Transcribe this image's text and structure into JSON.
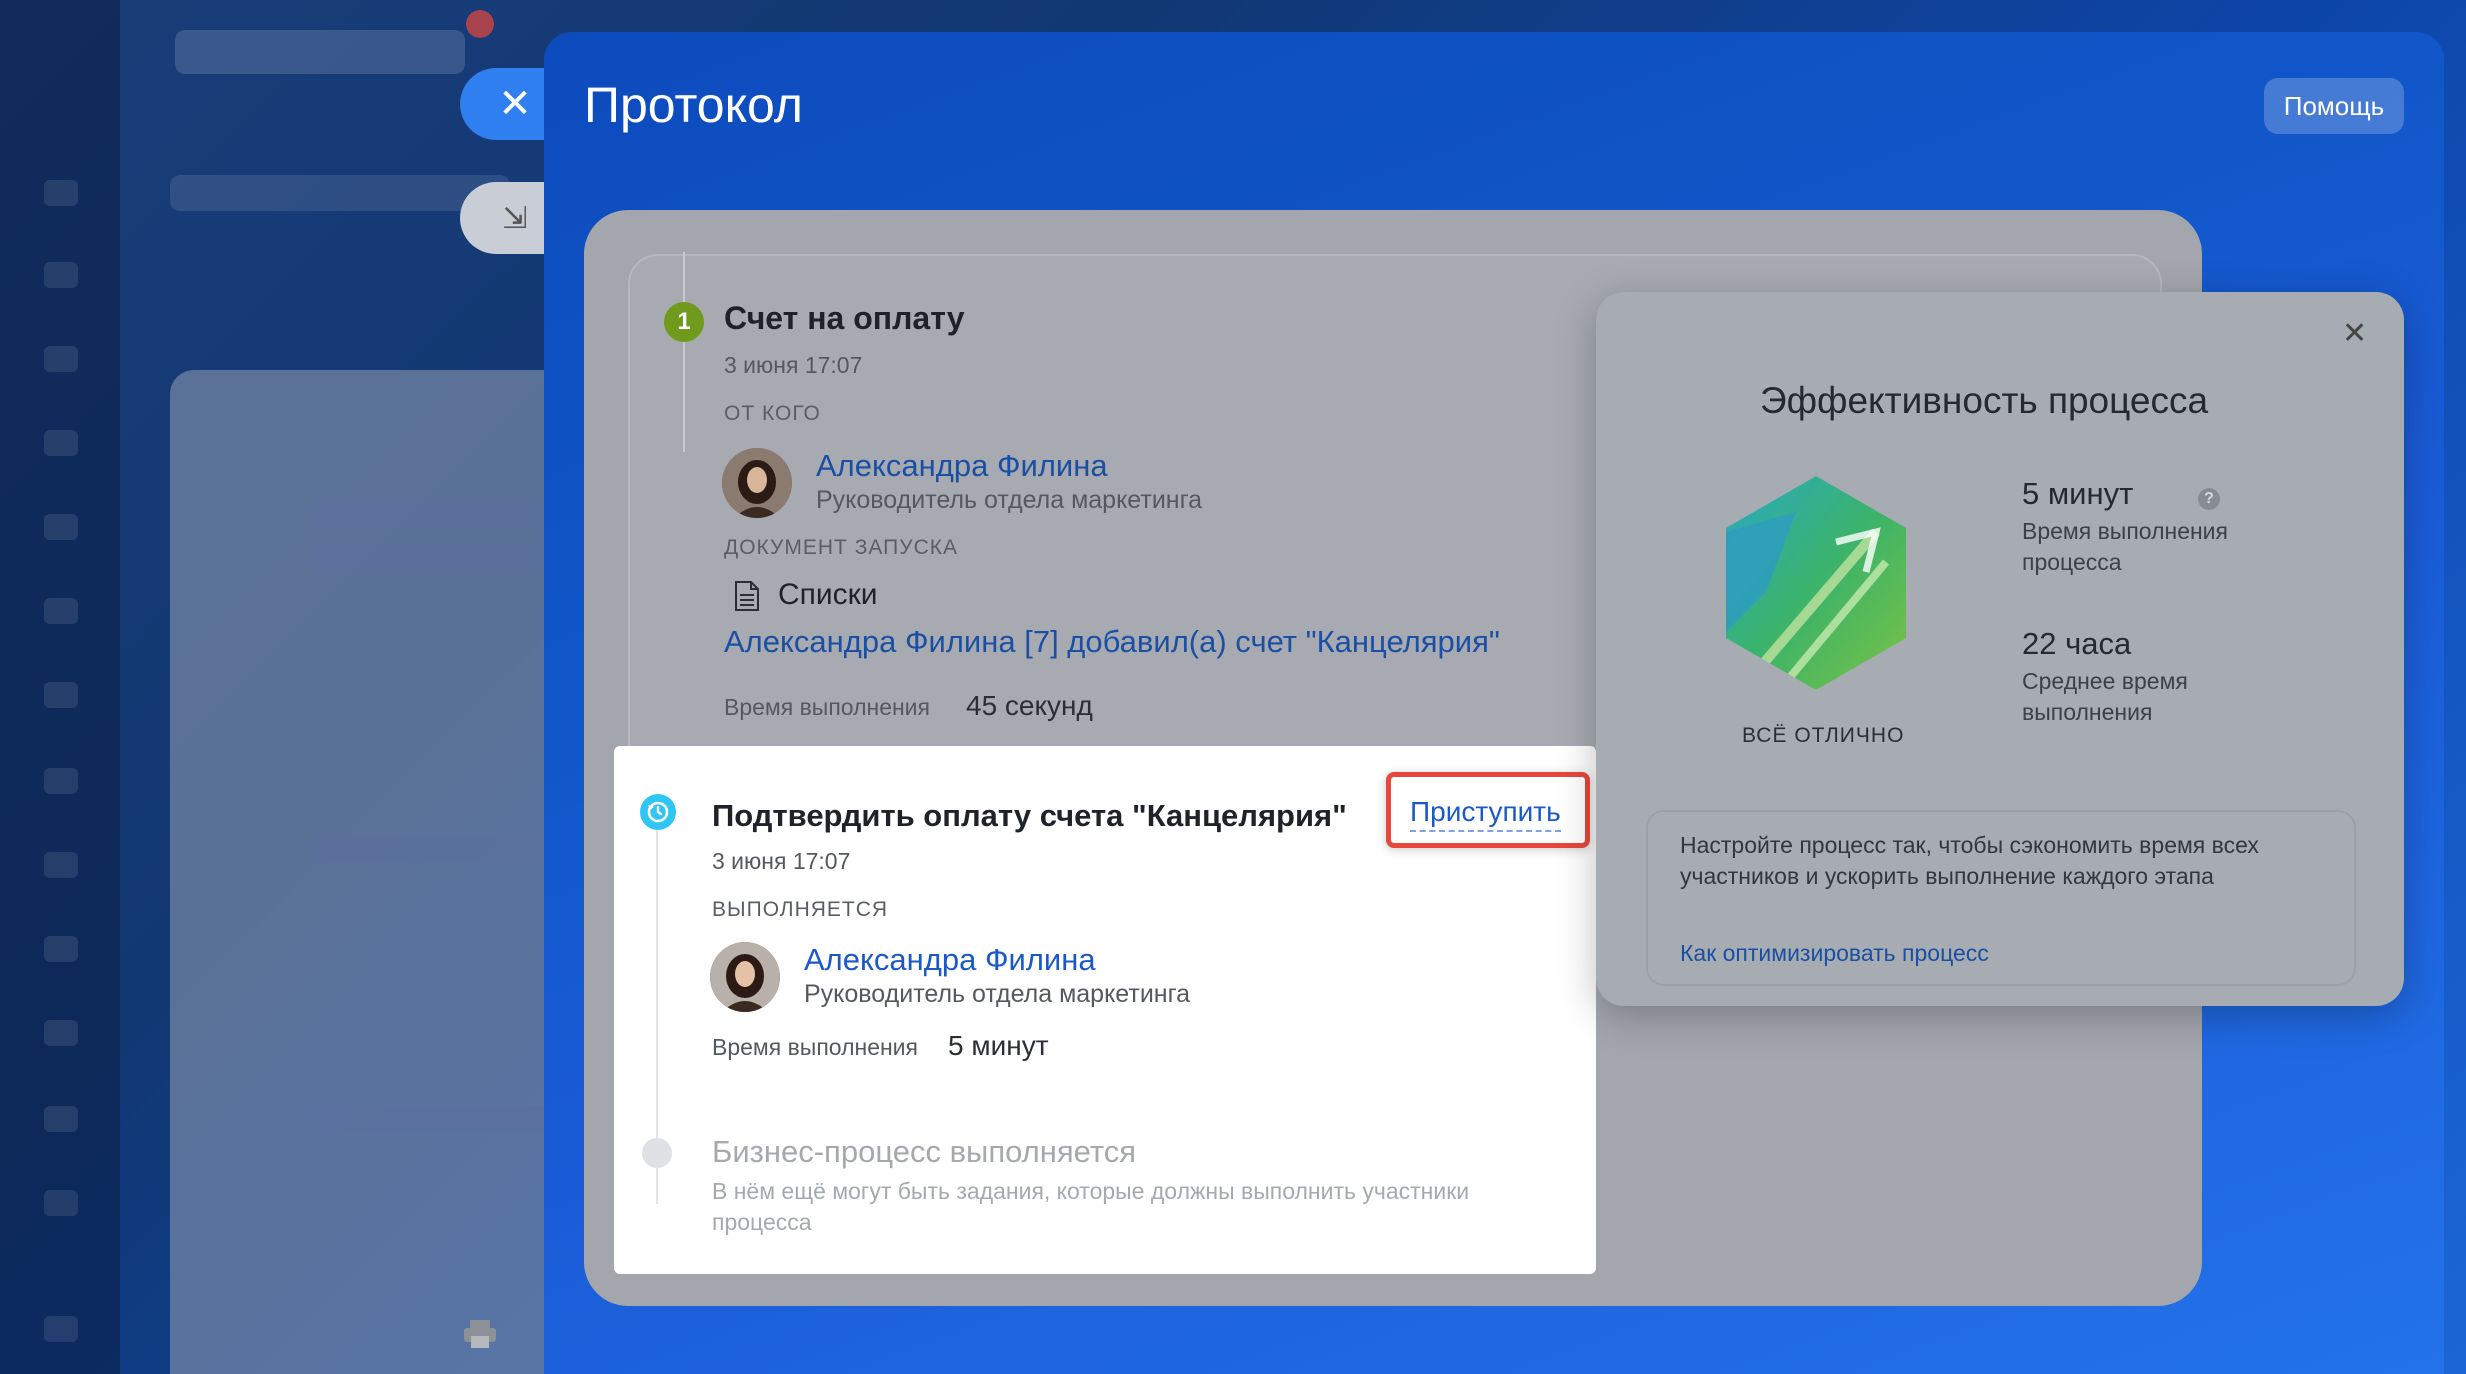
{
  "slider": {
    "title": "Протокол",
    "help_label": "Помощь"
  },
  "step1": {
    "number": "1",
    "title": "Счет на оплату",
    "date": "3 июня 17:07",
    "from_label": "ОТ КОГО",
    "person_name": "Александра Филина",
    "person_role": "Руководитель отдела маркетинга",
    "doc_label": "ДОКУМЕНТ ЗАПУСКА",
    "doc_type": "Списки",
    "doc_link": "Александра Филина [7] добавил(а) счет \"Канцелярия\"",
    "time_label": "Время выполнения",
    "time_value": "45 секунд"
  },
  "step2": {
    "title": "Подтвердить оплату счета \"Канцелярия\"",
    "action_label": "Приступить",
    "date": "3 июня 17:07",
    "status_label": "ВЫПОЛНЯЕТСЯ",
    "person_name": "Александра Филина",
    "person_role": "Руководитель отдела маркетинга",
    "time_label": "Время выполнения",
    "time_value": "5 минут"
  },
  "step3": {
    "title": "Бизнес-процесс выполняется",
    "description": "В нём ещё могут быть задания, которые должны выполнить участники процесса"
  },
  "efficiency": {
    "title": "Эффективность процесса",
    "status": "ВСЁ ОТЛИЧНО",
    "metric1_value": "5 минут",
    "metric1_label": "Время выполнения процесса",
    "metric2_value": "22 часа",
    "metric2_label": "Среднее время выполнения",
    "tip_text": "Настройте процесс так, чтобы сэкономить время всех участников и ускорить выполнение каждого этапа",
    "tip_link": "Как оптимизировать процесс",
    "close_icon": "close-icon"
  },
  "colors": {
    "accent_blue": "#1b58c9",
    "highlight_red": "#e8473c",
    "step1_green": "#6f9a1b",
    "step2_cyan": "#2fc6f6"
  }
}
